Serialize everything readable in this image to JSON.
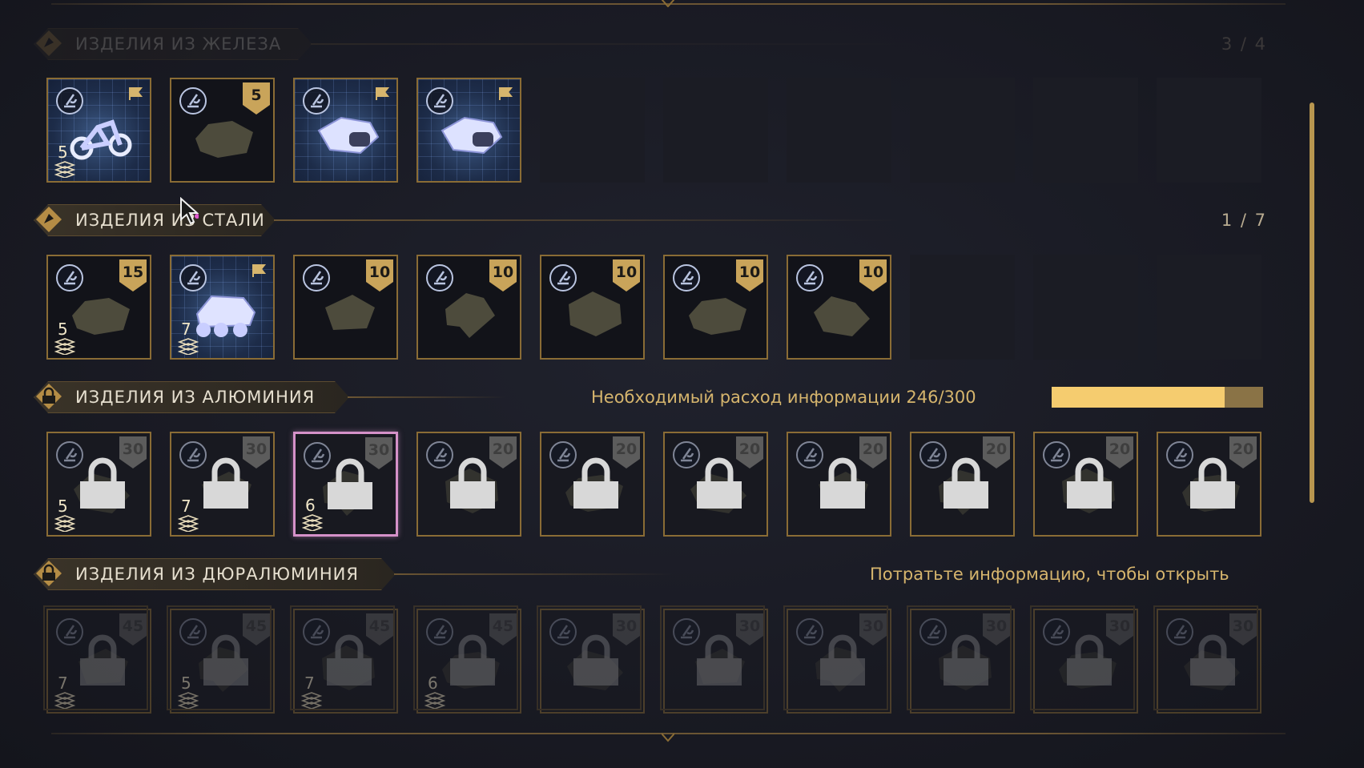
{
  "sections": [
    {
      "title": "ИЗДЕЛИЯ ИЗ ЖЕЛЕЗА",
      "count": "3 / 4",
      "state": "faded",
      "tiles": [
        {
          "state": "known",
          "count": "5",
          "badge": "",
          "badge_icon": "flag-icon",
          "art": "bike-icon"
        },
        {
          "state": "unknown",
          "count": "",
          "badge": "5",
          "art": "silhouette-icon"
        },
        {
          "state": "known",
          "count": "",
          "badge": "",
          "badge_icon": "flag-icon",
          "art": "engine-icon"
        },
        {
          "state": "known",
          "count": "",
          "badge": "",
          "badge_icon": "flag-icon",
          "art": "engine-icon"
        },
        {
          "state": "empty"
        },
        {
          "state": "empty"
        },
        {
          "state": "empty"
        },
        {
          "state": "empty"
        },
        {
          "state": "empty"
        },
        {
          "state": "empty"
        }
      ]
    },
    {
      "title": "ИЗДЕЛИЯ ИЗ СТАЛИ",
      "count": "1 / 7",
      "state": "normal",
      "tiles": [
        {
          "state": "unknown",
          "count": "5",
          "badge": "15",
          "art": "silhouette-icon"
        },
        {
          "state": "known",
          "count": "7",
          "badge": "",
          "badge_icon": "flag-icon",
          "art": "vehicle-icon"
        },
        {
          "state": "unknown",
          "count": "",
          "badge": "10",
          "art": "silhouette-icon"
        },
        {
          "state": "unknown",
          "count": "",
          "badge": "10",
          "art": "silhouette-icon"
        },
        {
          "state": "unknown",
          "count": "",
          "badge": "10",
          "art": "silhouette-icon"
        },
        {
          "state": "unknown",
          "count": "",
          "badge": "10",
          "art": "silhouette-icon"
        },
        {
          "state": "unknown",
          "count": "",
          "badge": "10",
          "art": "silhouette-icon"
        },
        {
          "state": "empty"
        },
        {
          "state": "empty"
        },
        {
          "state": "empty"
        }
      ]
    },
    {
      "title": "ИЗДЕЛИЯ ИЗ АЛЮМИНИЯ",
      "count": "",
      "note": "Необходимый расход информации 246/300",
      "progress": 0.82,
      "state": "normal",
      "tiles": [
        {
          "state": "locked",
          "count": "5",
          "badge": "30"
        },
        {
          "state": "locked",
          "count": "7",
          "badge": "30"
        },
        {
          "state": "locked",
          "count": "6",
          "badge": "30",
          "selected": true
        },
        {
          "state": "locked",
          "count": "",
          "badge": "20"
        },
        {
          "state": "locked",
          "count": "",
          "badge": "20"
        },
        {
          "state": "locked",
          "count": "",
          "badge": "20"
        },
        {
          "state": "locked",
          "count": "",
          "badge": "20"
        },
        {
          "state": "locked",
          "count": "",
          "badge": "20"
        },
        {
          "state": "locked",
          "count": "",
          "badge": "20"
        },
        {
          "state": "locked",
          "count": "",
          "badge": "20"
        }
      ]
    },
    {
      "title": "ИЗДЕЛИЯ ИЗ ДЮРАЛЮМИНИЯ",
      "count": "",
      "note": "Потратьте информацию, чтобы открыть",
      "state": "normal",
      "tiles": [
        {
          "state": "locked-dim",
          "count": "7",
          "badge": "45"
        },
        {
          "state": "locked-dim",
          "count": "5",
          "badge": "45"
        },
        {
          "state": "locked-dim",
          "count": "7",
          "badge": "45"
        },
        {
          "state": "locked-dim",
          "count": "6",
          "badge": "45"
        },
        {
          "state": "locked-dim",
          "count": "",
          "badge": "30"
        },
        {
          "state": "locked-dim",
          "count": "",
          "badge": "30"
        },
        {
          "state": "locked-dim",
          "count": "",
          "badge": "30"
        },
        {
          "state": "locked-dim",
          "count": "",
          "badge": "30"
        },
        {
          "state": "locked-dim",
          "count": "",
          "badge": "30"
        },
        {
          "state": "locked-dim",
          "count": "",
          "badge": "30"
        }
      ]
    }
  ],
  "colors": {
    "accent_gold": "#f5cc6f",
    "border_gold": "#8a6c35",
    "selected": "#d591c9",
    "text": "#e6dfcf",
    "note": "#d6b56d"
  }
}
